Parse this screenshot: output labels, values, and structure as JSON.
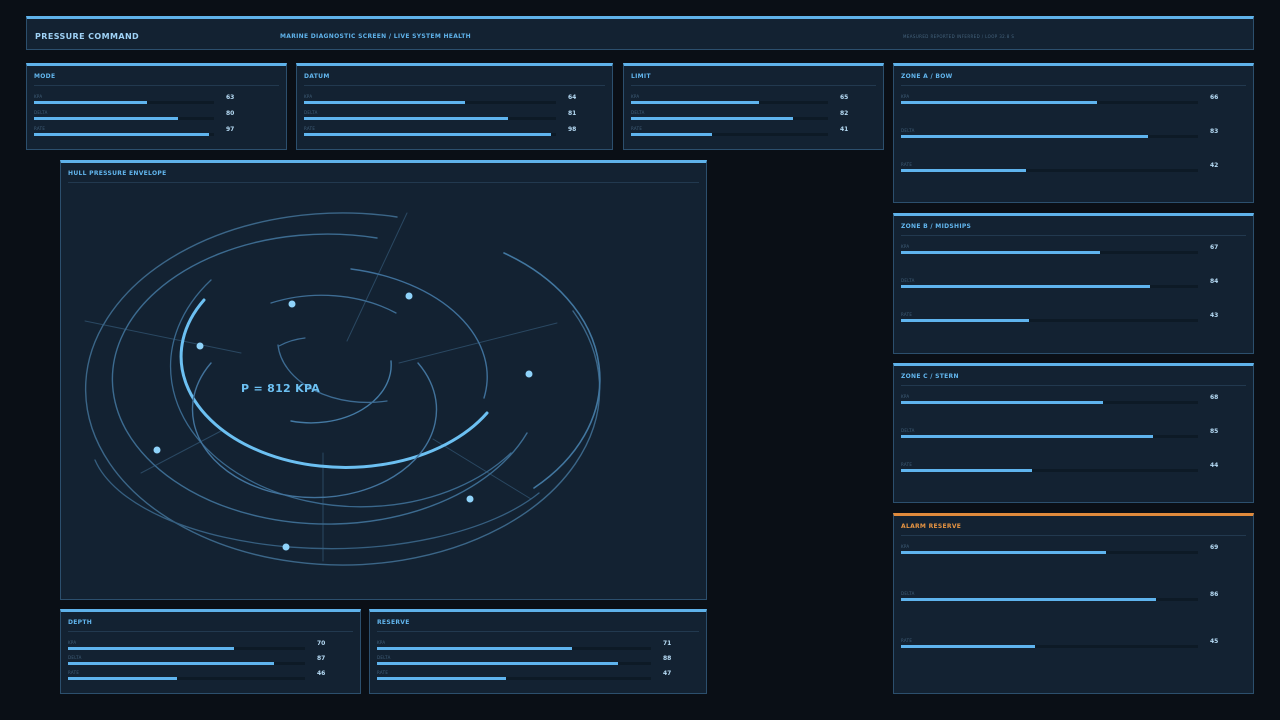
{
  "header": {
    "app_title": "PRESSURE COMMAND",
    "subtitle": "MARINE DIAGNOSTIC SCREEN / LIVE SYSTEM HEALTH",
    "legend": "MEASURED  REPORTED  INFERRED  /  LOOP 32.8 S"
  },
  "panels": {
    "mode": {
      "title": "MODE",
      "metrics": [
        {
          "label": "KPA",
          "value": "63",
          "fill": 0.63
        },
        {
          "label": "DELTA",
          "value": "80",
          "fill": 0.8
        },
        {
          "label": "RATE",
          "value": "97",
          "fill": 0.97
        }
      ]
    },
    "datum": {
      "title": "DATUM",
      "metrics": [
        {
          "label": "KPA",
          "value": "64",
          "fill": 0.64
        },
        {
          "label": "DELTA",
          "value": "81",
          "fill": 0.81
        },
        {
          "label": "RATE",
          "value": "98",
          "fill": 0.98
        }
      ]
    },
    "limit": {
      "title": "LIMIT",
      "metrics": [
        {
          "label": "KPA",
          "value": "65",
          "fill": 0.65
        },
        {
          "label": "DELTA",
          "value": "82",
          "fill": 0.82
        },
        {
          "label": "RATE",
          "value": "41",
          "fill": 0.41
        }
      ]
    },
    "zone_a": {
      "title": "ZONE A / BOW",
      "metrics": [
        {
          "label": "KPA",
          "value": "66",
          "fill": 0.66
        },
        {
          "label": "DELTA",
          "value": "83",
          "fill": 0.83
        },
        {
          "label": "RATE",
          "value": "42",
          "fill": 0.42
        }
      ]
    },
    "zone_b": {
      "title": "ZONE B / MIDSHIPS",
      "metrics": [
        {
          "label": "KPA",
          "value": "67",
          "fill": 0.67
        },
        {
          "label": "DELTA",
          "value": "84",
          "fill": 0.84
        },
        {
          "label": "RATE",
          "value": "43",
          "fill": 0.43
        }
      ]
    },
    "zone_c": {
      "title": "ZONE C / STERN",
      "metrics": [
        {
          "label": "KPA",
          "value": "68",
          "fill": 0.68
        },
        {
          "label": "DELTA",
          "value": "85",
          "fill": 0.85
        },
        {
          "label": "RATE",
          "value": "44",
          "fill": 0.44
        }
      ]
    },
    "alarm": {
      "title": "ALARM RESERVE",
      "metrics": [
        {
          "label": "KPA",
          "value": "69",
          "fill": 0.69
        },
        {
          "label": "DELTA",
          "value": "86",
          "fill": 0.86
        },
        {
          "label": "RATE",
          "value": "45",
          "fill": 0.45
        }
      ]
    },
    "depth": {
      "title": "DEPTH",
      "metrics": [
        {
          "label": "KPA",
          "value": "70",
          "fill": 0.7
        },
        {
          "label": "DELTA",
          "value": "87",
          "fill": 0.87
        },
        {
          "label": "RATE",
          "value": "46",
          "fill": 0.46
        }
      ]
    },
    "reserve": {
      "title": "RESERVE",
      "metrics": [
        {
          "label": "KPA",
          "value": "71",
          "fill": 0.71
        },
        {
          "label": "DELTA",
          "value": "88",
          "fill": 0.88
        },
        {
          "label": "RATE",
          "value": "47",
          "fill": 0.47
        }
      ]
    }
  },
  "hull": {
    "title": "HULL PRESSURE ENVELOPE",
    "readout": "P = 812 KPA"
  },
  "colors": {
    "accent": "#5fb4ee",
    "alarm": "#e08a3c",
    "panel": "#132232",
    "background": "#0a0f16"
  }
}
